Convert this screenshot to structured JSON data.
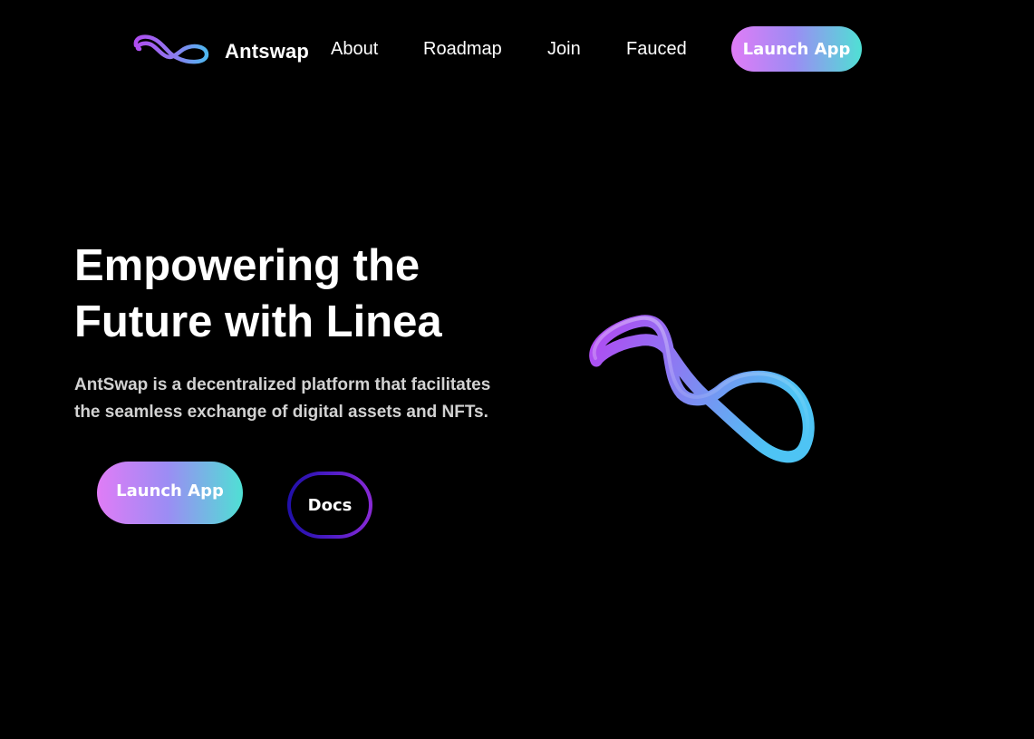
{
  "brand": {
    "name": "Antswap",
    "logo_icon": "infinity-ribbon-icon"
  },
  "nav": {
    "items": [
      {
        "label": "About"
      },
      {
        "label": "Roadmap"
      },
      {
        "label": "Join"
      },
      {
        "label": "Fauced"
      }
    ],
    "launch_label": "Launch App"
  },
  "hero": {
    "title_line1": "Empowering the",
    "title_line2": "Future with Linea",
    "desc_line1": "AntSwap is a decentralized platform that facilitates",
    "desc_line2": "the seamless exchange of digital assets and NFTs.",
    "launch_label": "Launch App",
    "docs_label": "Docs",
    "graphic_icon": "infinity-3d-icon"
  },
  "colors": {
    "background": "#000000",
    "gradient_start": "#e07cf6",
    "gradient_mid": "#9c8cf4",
    "gradient_end": "#4fe0d4",
    "docs_border_start": "#1f0fa8",
    "docs_border_end": "#8a2ad6",
    "text": "#ffffff",
    "muted_text": "#d2d2d2"
  }
}
